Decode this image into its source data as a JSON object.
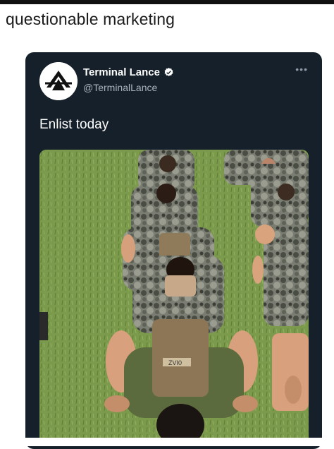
{
  "caption": "questionable marketing",
  "tweet": {
    "display_name": "Terminal Lance",
    "handle": "@TerminalLance",
    "text": "Enlist today",
    "more_label": "•••",
    "verified_icon": "verified-badge-icon",
    "avatar_icon": "terminal-lance-logo",
    "photo_text": "ZVI0"
  },
  "colors": {
    "card_bg": "#15202b",
    "handle": "#a8b3bd",
    "grass": "#7c9a4e"
  }
}
